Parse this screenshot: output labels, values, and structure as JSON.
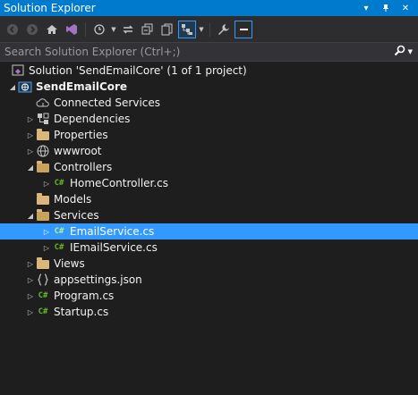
{
  "window": {
    "title": "Solution Explorer",
    "title_icons": [
      "dropdown-icon",
      "pin-icon",
      "close-icon"
    ]
  },
  "toolbar": {
    "buttons": [
      "back-icon",
      "forward-icon",
      "home-icon",
      "vs-switch-icon",
      "history-icon",
      "sync-icon",
      "collapse-all-icon",
      "show-all-files-icon",
      "filter-icon",
      "properties-icon",
      "preview-icon"
    ]
  },
  "search": {
    "placeholder": "Search Solution Explorer (Ctrl+;)"
  },
  "tree": {
    "solution_label": "Solution 'SendEmailCore' (1 of 1 project)",
    "project_label": "SendEmailCore",
    "items": [
      {
        "label": "Connected Services",
        "icon": "cloud-icon"
      },
      {
        "label": "Dependencies",
        "icon": "dependencies-icon"
      },
      {
        "label": "Properties",
        "icon": "wrench-folder-icon"
      },
      {
        "label": "wwwroot",
        "icon": "globe-icon"
      },
      {
        "label": "Controllers",
        "icon": "folder-open-icon"
      },
      {
        "label": "HomeController.cs",
        "icon": "csharp-file-icon"
      },
      {
        "label": "Models",
        "icon": "folder-icon"
      },
      {
        "label": "Services",
        "icon": "folder-open-icon"
      },
      {
        "label": "EmailService.cs",
        "icon": "csharp-file-icon",
        "selected": true
      },
      {
        "label": "IEmailService.cs",
        "icon": "csharp-file-icon"
      },
      {
        "label": "Views",
        "icon": "folder-icon"
      },
      {
        "label": "appsettings.json",
        "icon": "json-file-icon"
      },
      {
        "label": "Program.cs",
        "icon": "csharp-file-icon"
      },
      {
        "label": "Startup.cs",
        "icon": "csharp-file-icon"
      }
    ]
  },
  "colors": {
    "accent": "#007acc",
    "selection": "#3399ff",
    "background": "#1e1e1e",
    "folder": "#dcb67a",
    "csharp": "#68b723"
  }
}
